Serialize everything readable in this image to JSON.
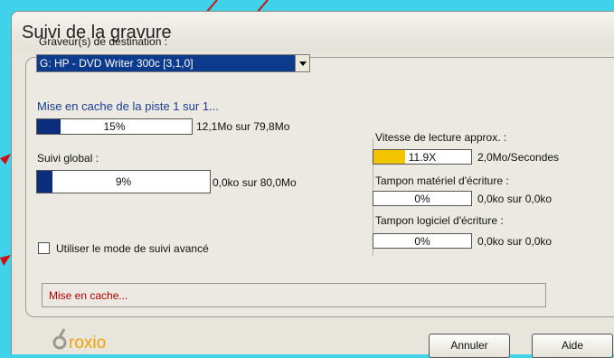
{
  "window": {
    "title": "Suivi de la gravure"
  },
  "recorder": {
    "label": "Graveur(s) de destination :",
    "selected": "G: HP - DVD Writer 300c [3,1,0]"
  },
  "cache": {
    "status": "Mise en cache de la piste 1 sur 1...",
    "percent": 0.15,
    "percent_text": "15%",
    "size_text": "12,1Mo sur 79,8Mo"
  },
  "overall": {
    "label": "Suivi global :",
    "percent": 0.09,
    "percent_text": "9%",
    "size_text": "0,0ko sur 80,0Mo"
  },
  "advanced_mode": {
    "label": "Utiliser le mode de suivi avancé",
    "checked": false
  },
  "read_speed": {
    "label": "Vitesse de lecture approx. :",
    "level": 0.32,
    "bar_text": "11.9X",
    "value_text": "2,0Mo/Secondes"
  },
  "hw_buffer": {
    "label": "Tampon matériel d'écriture :",
    "level": 0,
    "bar_text": "0%",
    "value_text": "0,0ko sur 0,0ko"
  },
  "sw_buffer": {
    "label": "Tampon logiciel d'écriture :",
    "level": 0,
    "bar_text": "0%",
    "value_text": "0,0ko sur 0,0ko"
  },
  "status_box": {
    "text": "Mise en cache..."
  },
  "buttons": {
    "cancel": "Annuler",
    "help": "Aide"
  },
  "logo": {
    "text": "roxio"
  },
  "colors": {
    "progress": "#0c2d7c",
    "speed": "#f2c400",
    "status_text": "#b30000",
    "accent_text": "#1b3f93"
  }
}
